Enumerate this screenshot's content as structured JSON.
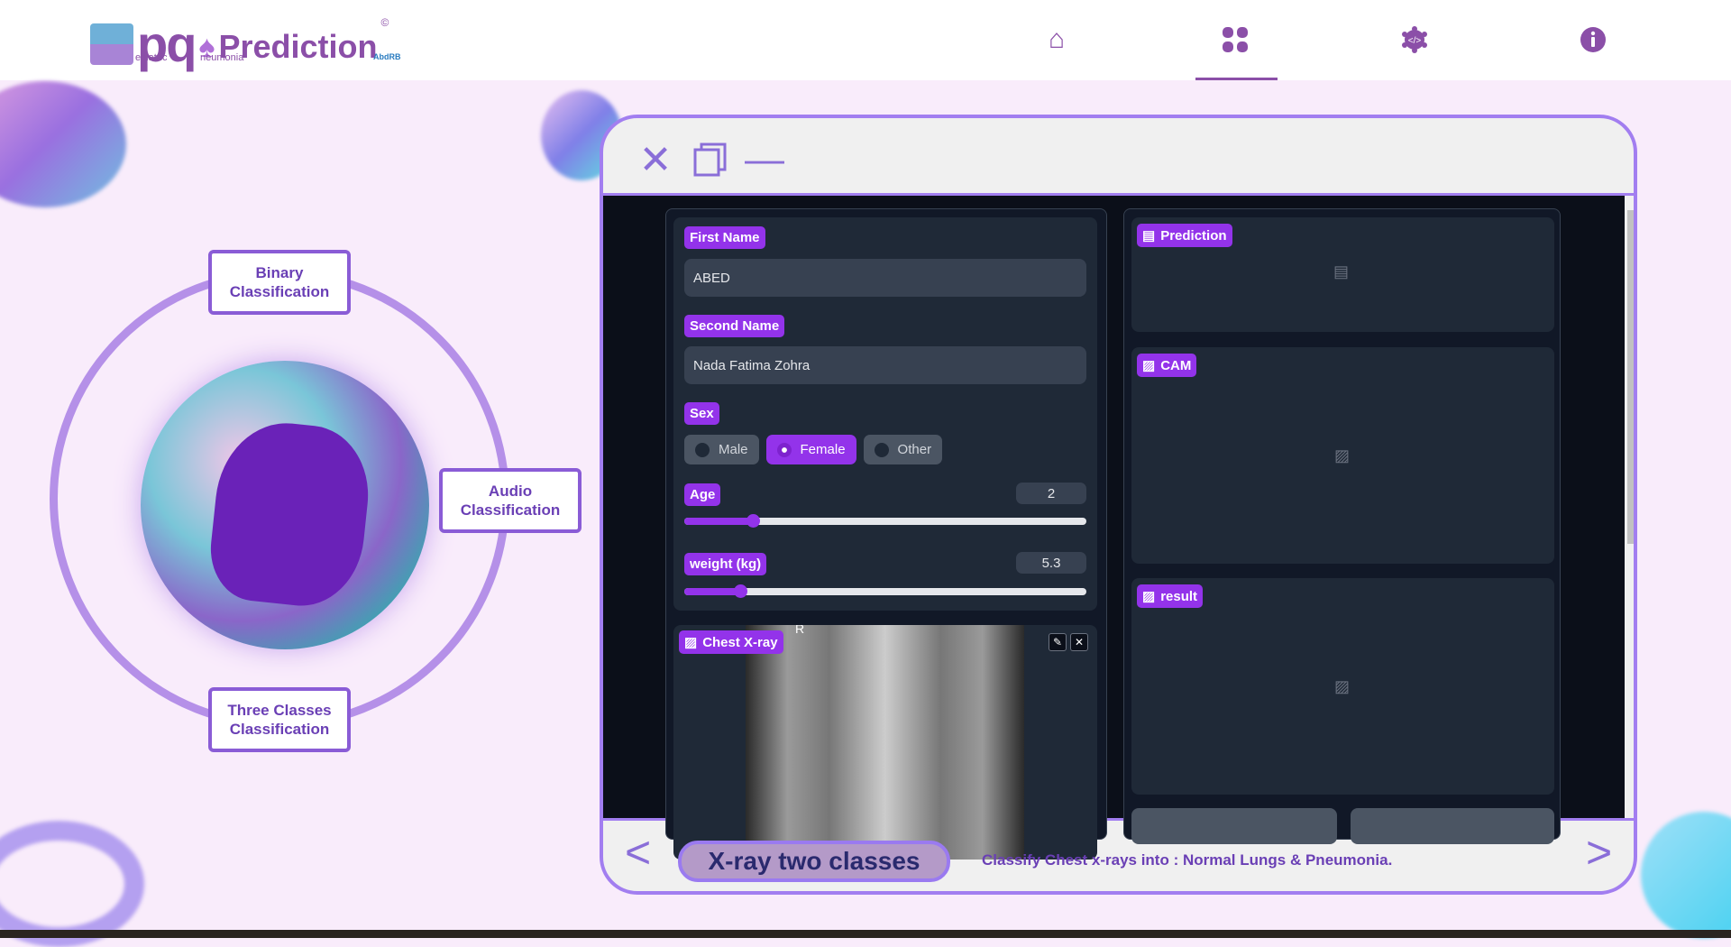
{
  "header": {
    "logo_text": "Prediction",
    "logo_sub1": "ediatric",
    "logo_sub2": "neumonia",
    "logo_brand": "AbdRB",
    "nav": [
      {
        "icon": "home-icon"
      },
      {
        "icon": "grid-icon",
        "active": true
      },
      {
        "icon": "code-gear-icon"
      },
      {
        "icon": "info-icon"
      }
    ]
  },
  "classifiers": {
    "binary": "Binary Classification",
    "audio": "Audio Classification",
    "three": "Three Classes Classification"
  },
  "form": {
    "first_name_label": "First Name",
    "first_name": "ABED",
    "second_name_label": "Second Name",
    "second_name": "Nada Fatima Zohra",
    "sex_label": "Sex",
    "sex_options": [
      "Male",
      "Female",
      "Other"
    ],
    "sex_selected": "Female",
    "age_label": "Age",
    "age": "2",
    "age_fraction": 0.17,
    "weight_label": "weight (kg)",
    "weight": "5.3",
    "weight_fraction": 0.14,
    "xray_label": "Chest X-ray",
    "xray_marker": "R"
  },
  "outputs": {
    "prediction_label": "Prediction",
    "cam_label": "CAM",
    "result_label": "result"
  },
  "bottom": {
    "model_name": "X-ray two classes",
    "description": "Classify Chest x-rays into : Normal Lungs & Pneumonia.",
    "prev": "<",
    "next": ">"
  },
  "colors": {
    "accent": "#9333ea",
    "brand": "#8b4fa8",
    "frame": "#a27ef0"
  }
}
